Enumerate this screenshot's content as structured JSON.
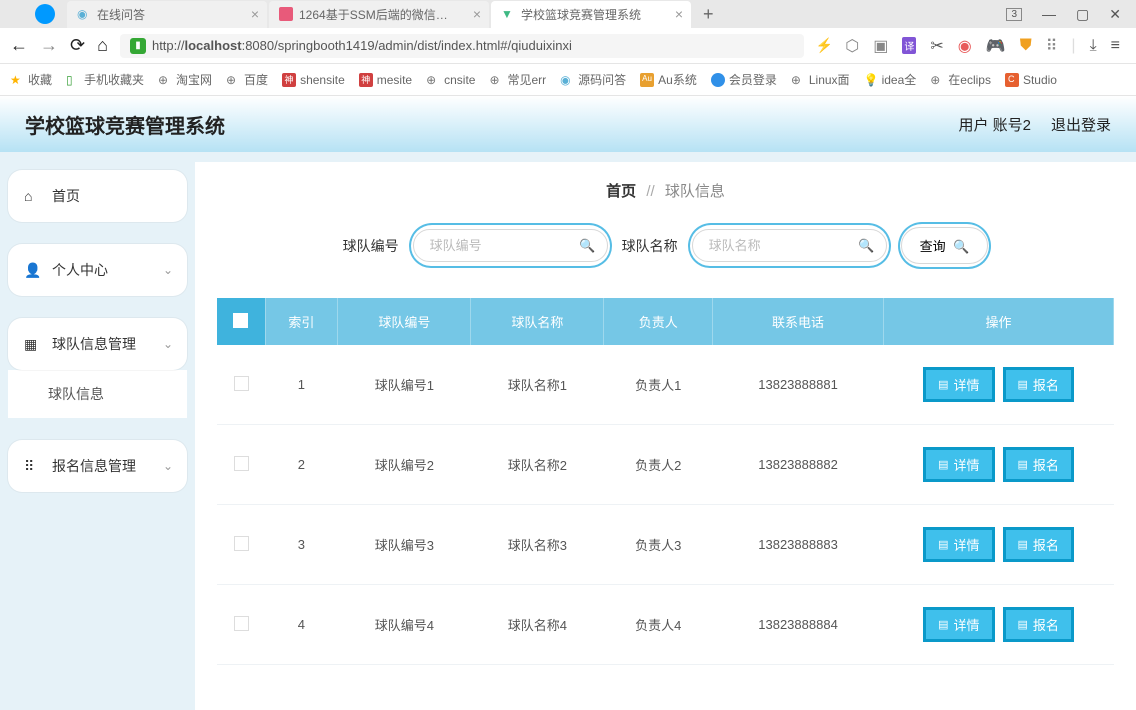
{
  "browser": {
    "tabs": [
      {
        "label": "在线问答"
      },
      {
        "label": "1264基于SSM后端的微信公…"
      },
      {
        "label": "学校篮球竞赛管理系统",
        "active": true
      }
    ],
    "url_prefix": "http://",
    "url_host": "localhost",
    "url_rest": ":8080/springbooth1419/admin/dist/index.html#/qiuduixinxi",
    "window_number": "3"
  },
  "bookmarks": [
    {
      "label": "收藏",
      "icon": "star"
    },
    {
      "label": "手机收藏夹",
      "icon": "phone"
    },
    {
      "label": "淘宝网",
      "icon": "globe"
    },
    {
      "label": "百度",
      "icon": "globe"
    },
    {
      "label": "shensite",
      "icon": "red"
    },
    {
      "label": "mesite",
      "icon": "red"
    },
    {
      "label": "cnsite",
      "icon": "globe"
    },
    {
      "label": "常见err",
      "icon": "globe"
    },
    {
      "label": "源码问答",
      "icon": "swirl"
    },
    {
      "label": "Au系统",
      "icon": "au"
    },
    {
      "label": "会员登录",
      "icon": "blue"
    },
    {
      "label": "Linux面",
      "icon": "globe"
    },
    {
      "label": "idea全",
      "icon": "bulb"
    },
    {
      "label": "在eclips",
      "icon": "globe"
    },
    {
      "label": "Studio",
      "icon": "c"
    }
  ],
  "app": {
    "title": "学校篮球竞赛管理系统",
    "user_label": "用户 账号2",
    "logout": "退出登录"
  },
  "sidebar": {
    "home": "首页",
    "personal": "个人中心",
    "team_mgmt": "球队信息管理",
    "team_info": "球队信息",
    "signup_mgmt": "报名信息管理"
  },
  "breadcrumb": {
    "home": "首页",
    "current": "球队信息"
  },
  "search": {
    "label_code": "球队编号",
    "ph_code": "球队编号",
    "label_name": "球队名称",
    "ph_name": "球队名称",
    "query": "查询"
  },
  "table": {
    "headers": {
      "index": "索引",
      "code": "球队编号",
      "name": "球队名称",
      "owner": "负责人",
      "phone": "联系电话",
      "ops": "操作"
    },
    "op_detail": "详情",
    "op_signup": "报名",
    "rows": [
      {
        "idx": "1",
        "code": "球队编号1",
        "name": "球队名称1",
        "owner": "负责人1",
        "phone": "13823888881"
      },
      {
        "idx": "2",
        "code": "球队编号2",
        "name": "球队名称2",
        "owner": "负责人2",
        "phone": "13823888882"
      },
      {
        "idx": "3",
        "code": "球队编号3",
        "name": "球队名称3",
        "owner": "负责人3",
        "phone": "13823888883"
      },
      {
        "idx": "4",
        "code": "球队编号4",
        "name": "球队名称4",
        "owner": "负责人4",
        "phone": "13823888884"
      }
    ]
  }
}
